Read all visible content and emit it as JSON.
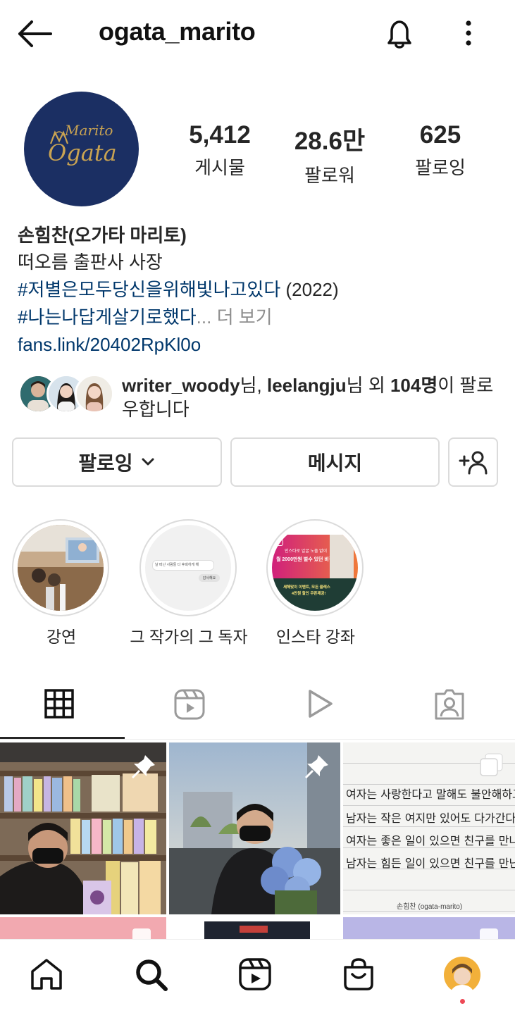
{
  "header": {
    "username": "ogata_marito"
  },
  "profile": {
    "avatar_text_top": "Marito",
    "avatar_text_bottom": "Ogata",
    "stats": [
      {
        "value": "5,412",
        "label": "게시물"
      },
      {
        "value": "28.6만",
        "label": "팔로워"
      },
      {
        "value": "625",
        "label": "팔로잉"
      }
    ],
    "name": "손힘찬(오가타 마리토)",
    "bio_line": "떠오름 출판사 사장",
    "hashtag1": "#저별은모두당신을위해빛나고있다",
    "hashtag1_suffix": " (2022)",
    "hashtag2": "#나는나답게살기로했다",
    "ellipsis": "...",
    "more": " 더 보기",
    "link": "fans.link/20402RpKl0o"
  },
  "followed_by": {
    "user1": "writer_woody",
    "suffix1": "님, ",
    "user2": "leelangju",
    "suffix2": "님 외 ",
    "count": "104명",
    "suffix3": "이 팔로우합니다"
  },
  "actions": {
    "following": "팔로잉",
    "message": "메시지"
  },
  "highlights": [
    {
      "label": "강연"
    },
    {
      "label": "그 작가의 그 독자"
    },
    {
      "label": "인스타 강좌"
    }
  ],
  "highlight_texts": {
    "chat1": "날 떠난 사람들 다 후회하게 해",
    "chat2": "감사해요",
    "promo_header": "인스타로 얼굴 노출 없이",
    "promo_main": "월 2000만원 벌수 있던 비결",
    "promo_bottom1": "새해맞이 이벤트, 모든 클래스",
    "promo_bottom2": "4만원 할인 쿠폰제공!"
  },
  "note_post": {
    "lines": [
      "여자는 사랑한다고 말해도 불안해하고",
      "남자는 작은 여지만 있어도 다가간다.",
      "여자는 좋은 일이 있으면 친구를 만나고",
      "남자는 힘든 일이 있으면 친구를 만난다."
    ],
    "signature": "손힘찬 (ogata-marito)"
  },
  "colors": {
    "hashtag": "#00376b",
    "avatar_bg": "#1b2f63",
    "avatar_gold": "#c9a352",
    "notification_dot": "#ed4956"
  }
}
